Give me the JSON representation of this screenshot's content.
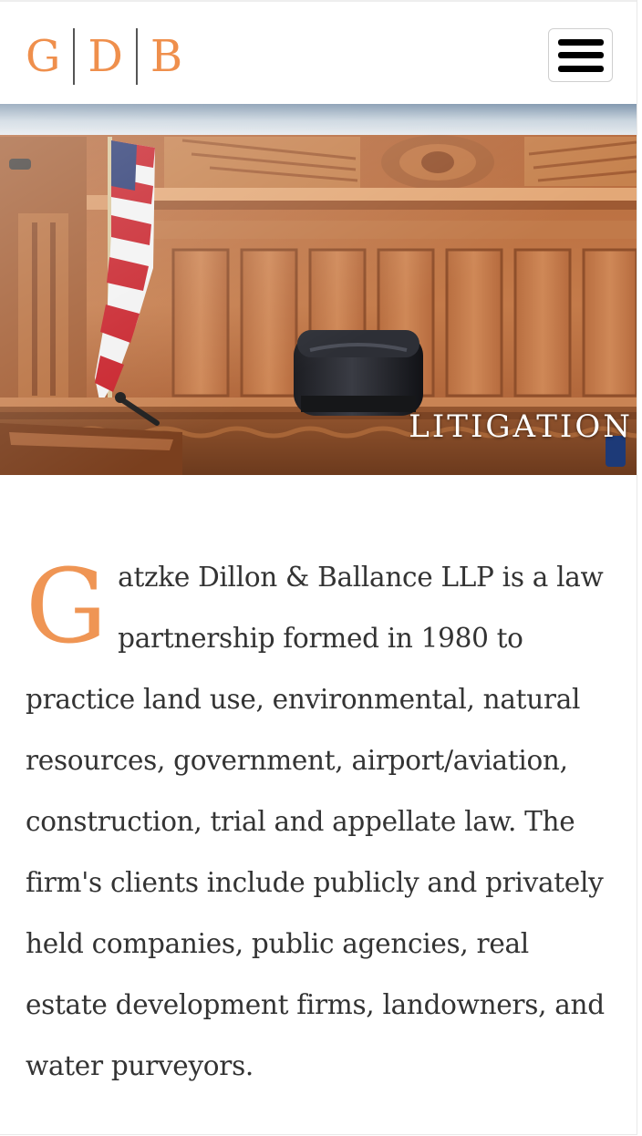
{
  "logo": {
    "letters": [
      "G",
      "D",
      "B"
    ]
  },
  "header": {
    "menu_icon": "hamburger-menu-icon"
  },
  "hero": {
    "caption": "LITIGATION"
  },
  "intro": {
    "dropcap": "G",
    "text": "atzke Dillon & Ballance LLP is a law partnership formed in 1980 to practice land use, environmental, natural resources, government, airport/aviation, construction, trial and appellate law. The firm's clients include publicly and privately held companies, public agencies, real estate development firms, landowners, and water purveyors."
  },
  "colors": {
    "brand_orange": "#ef8f4c",
    "text": "#333333",
    "separator": "#555555"
  }
}
